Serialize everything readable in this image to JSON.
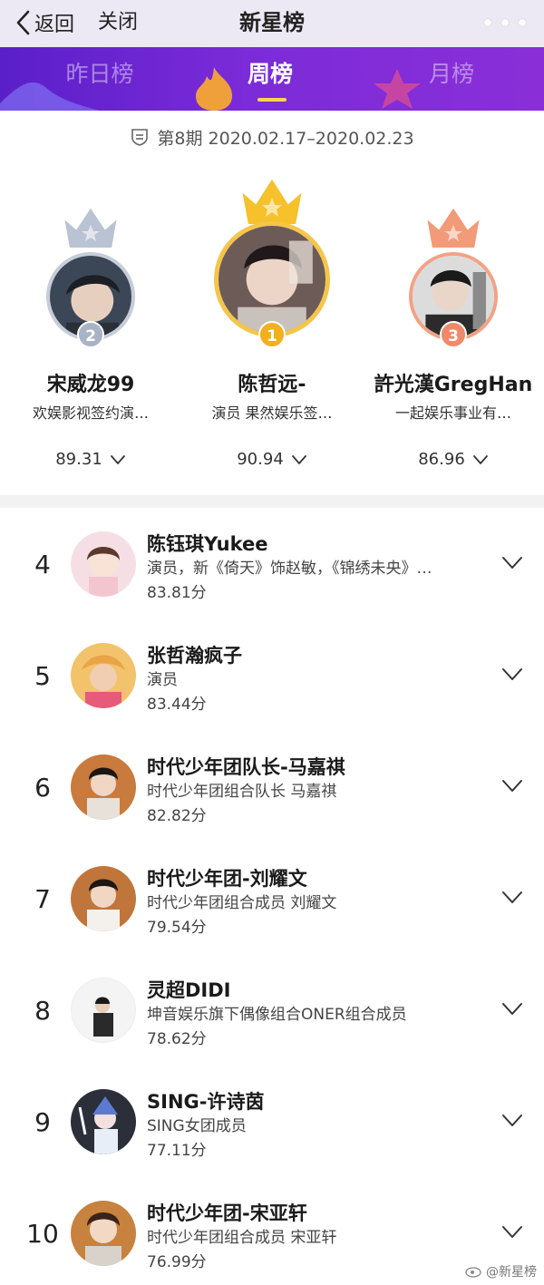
{
  "nav": {
    "back_label": "返回",
    "close_label": "关闭",
    "title": "新星榜"
  },
  "tabs": [
    {
      "label": "昨日榜",
      "active": false
    },
    {
      "label": "周榜",
      "active": true
    },
    {
      "label": "月榜",
      "active": false
    }
  ],
  "period": {
    "text": "第8期 2020.02.17–2020.02.23"
  },
  "podium": [
    {
      "rank": "2",
      "name": "宋威龙99",
      "desc": "欢娱影视签约演…",
      "score": "89.31",
      "crown_color": "#b9c3d3",
      "badge_color": "#a8b3c5"
    },
    {
      "rank": "1",
      "name": "陈哲远-",
      "desc": "演员 果然娱乐签…",
      "score": "90.94",
      "crown_color": "#f6c12a",
      "badge_color": "#f2b01e"
    },
    {
      "rank": "3",
      "name": "許光漢GregHan",
      "desc": "一起娱乐事业有…",
      "score": "86.96",
      "crown_color": "#f39a78",
      "badge_color": "#ee8a6a"
    }
  ],
  "list": [
    {
      "rank": "4",
      "name": "陈钰琪Yukee",
      "desc": "演员，新《倚天》饰赵敏，《锦绣未央》…",
      "score": "83.81分",
      "avatar_bg": "#f6dfe4"
    },
    {
      "rank": "5",
      "name": "张哲瀚疯子",
      "desc": "演员",
      "score": "83.44分",
      "avatar_bg": "#f2c36a"
    },
    {
      "rank": "6",
      "name": "时代少年团队长-马嘉祺",
      "desc": "时代少年团组合队长 马嘉祺",
      "score": "82.82分",
      "avatar_bg": "#c97a3d"
    },
    {
      "rank": "7",
      "name": "时代少年团-刘耀文",
      "desc": "时代少年团组合成员 刘耀文",
      "score": "79.54分",
      "avatar_bg": "#c0763b"
    },
    {
      "rank": "8",
      "name": "灵超DIDI",
      "desc": "坤音娱乐旗下偶像组合ONER组合成员",
      "score": "78.62分",
      "avatar_bg": "#f4f4f4"
    },
    {
      "rank": "9",
      "name": "SING-许诗茵",
      "desc": "SING女团成员",
      "score": "77.11分",
      "avatar_bg": "#2a2f3a"
    },
    {
      "rank": "10",
      "name": "时代少年团-宋亚轩",
      "desc": "时代少年团组合成员 宋亚轩",
      "score": "76.99分",
      "avatar_bg": "#c8823f"
    }
  ],
  "watermark": "@新星榜",
  "icons": {
    "back": "chevron-left-icon",
    "more": "more-dots-icon",
    "period": "calendar-icon",
    "expand": "chevron-down-icon",
    "crown": "crown-icon",
    "watermark": "weibo-icon"
  }
}
